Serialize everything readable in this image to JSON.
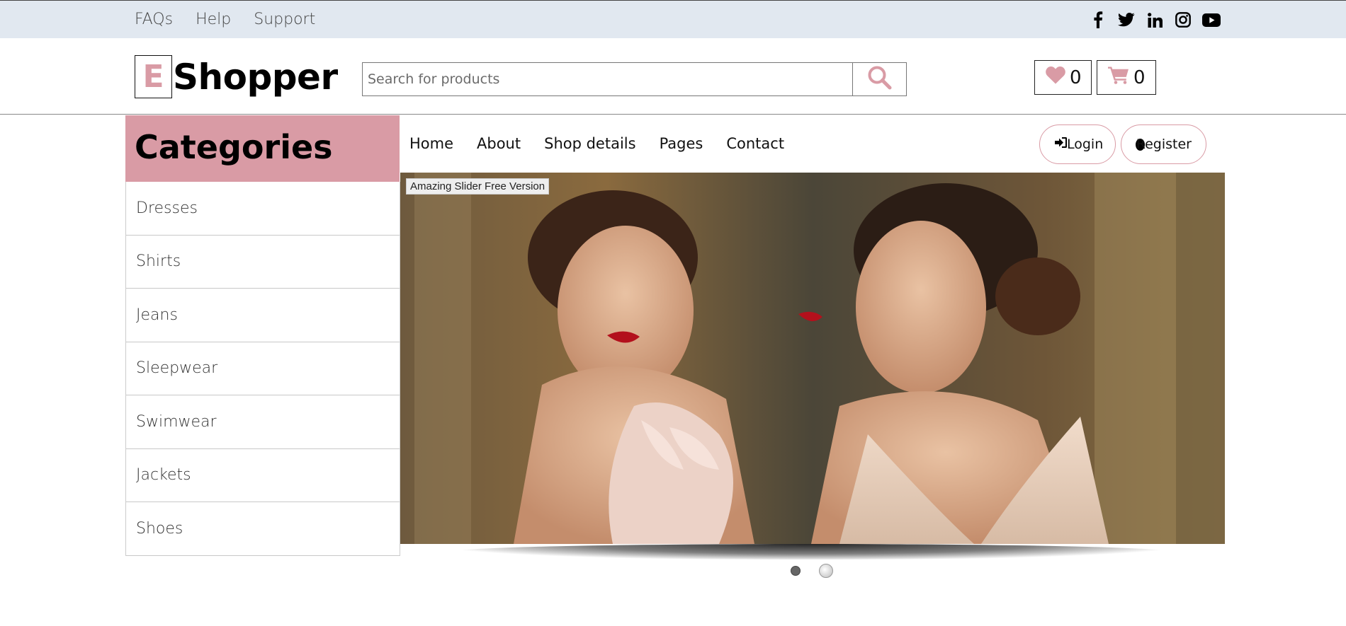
{
  "topbar": {
    "links": [
      "FAQs",
      "Help",
      "Support"
    ],
    "social_icons": [
      "facebook-icon",
      "twitter-icon",
      "linkedin-icon",
      "instagram-icon",
      "youtube-icon"
    ]
  },
  "logo": {
    "letter": "E",
    "rest": "Shopper"
  },
  "search": {
    "placeholder": "Search for products",
    "value": ""
  },
  "wishlist": {
    "count": "0"
  },
  "cart": {
    "count": "0"
  },
  "categories": {
    "title": "Categories",
    "items": [
      "Dresses",
      "Shirts",
      "Jeans",
      "Sleepwear",
      "Swimwear",
      "Jackets",
      "Shoes"
    ]
  },
  "nav": {
    "items": [
      "Home",
      "About",
      "Shop details",
      "Pages",
      "Contact"
    ]
  },
  "auth": {
    "login_label": "Login",
    "register_label": "Register"
  },
  "slider": {
    "watermark": "Amazing Slider Free Version",
    "slide_count": 2,
    "active_slide": 1
  },
  "colors": {
    "accent": "#d99ba5",
    "topbar_bg": "#e1e8f0"
  }
}
